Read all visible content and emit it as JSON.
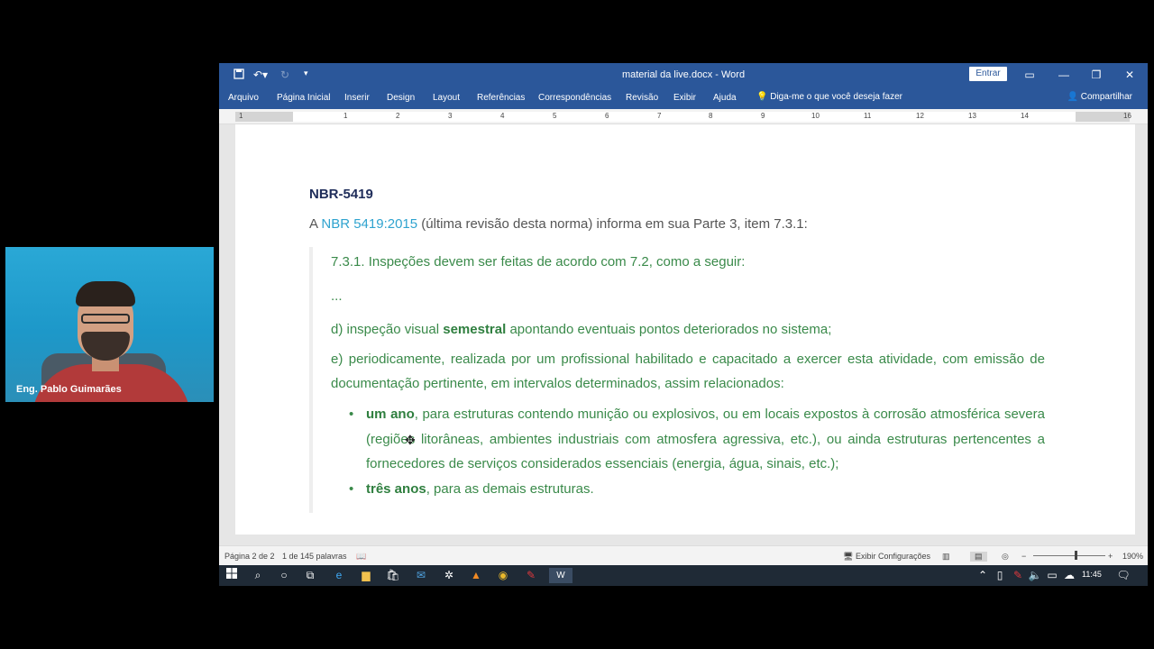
{
  "window": {
    "title": "material da live.docx  -  Word",
    "signin_label": "Entrar"
  },
  "menu": {
    "items": [
      "Arquivo",
      "Página Inicial",
      "Inserir",
      "Design",
      "Layout",
      "Referências",
      "Correspondências",
      "Revisão",
      "Exibir",
      "Ajuda"
    ],
    "tell_me": "Diga-me o que você deseja fazer",
    "share": "Compartilhar"
  },
  "ruler": {
    "numbers": [
      "1",
      "1",
      "2",
      "3",
      "4",
      "5",
      "6",
      "7",
      "8",
      "9",
      "10",
      "11",
      "12",
      "13",
      "14",
      "16"
    ]
  },
  "document": {
    "heading": "NBR-5419",
    "intro_prefix": "A ",
    "intro_link": "NBR 5419:2015",
    "intro_suffix": " (última revisão desta norma) informa em sua Parte 3, item 7.3.1:",
    "quote_line1": "7.3.1. Inspeções devem ser feitas de acordo com 7.2, como a seguir:",
    "ellipsis": "...",
    "item_d_prefix": "d) inspeção visual ",
    "item_d_bold": "semestral",
    "item_d_suffix": " apontando eventuais pontos deteriorados no sistema;",
    "item_e": "e) periodicamente, realizada por um profissional habilitado e capacitado a exercer esta atividade, com emissão de documentação pertinente, em intervalos determinados, assim relacionados:",
    "bullet1_bold": "um ano",
    "bullet1_text": ", para estruturas contendo munição ou explosivos, ou em locais expostos à corrosão atmosférica severa (regiões litorâneas, ambientes industriais com atmosfera agressiva, etc.), ou ainda estruturas pertencentes a fornecedores de serviços considerados essenciais (energia, água, sinais, etc.);",
    "bullet2_bold": "três anos",
    "bullet2_text": ", para as demais estruturas."
  },
  "status": {
    "page": "Página 2 de 2",
    "words": "1 de 145 palavras",
    "display_settings": "Exibir Configurações",
    "zoom": "190%",
    "zoom_fraction": 0.57
  },
  "taskbar": {
    "time": "11:45"
  },
  "webcam": {
    "name": "Eng. Pablo Guimarães"
  },
  "colors": {
    "word_blue": "#2b579a",
    "quote_green": "#3a8a4a",
    "link_blue": "#2fa3cf",
    "heading_navy": "#1f2d5a"
  }
}
